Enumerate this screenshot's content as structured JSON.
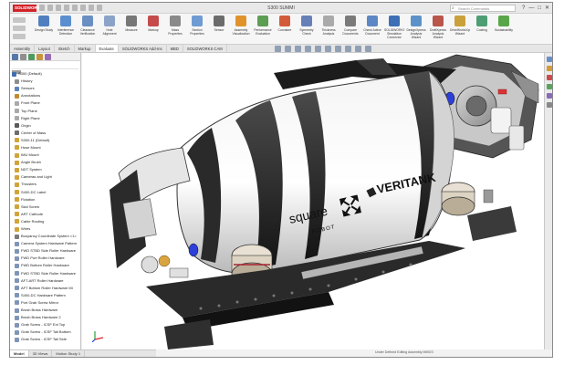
{
  "app": {
    "logo_text": "SOLIDWORKS",
    "window_title": "S300 SUMMI",
    "search_placeholder": "Search Commands",
    "window_buttons": [
      "?",
      "—",
      "□",
      "✕"
    ]
  },
  "ribbon": {
    "items": [
      {
        "label": "Design Study",
        "color": "#4f7fbf"
      },
      {
        "label": "Interference Detection",
        "color": "#5b8fd0"
      },
      {
        "label": "Clearance Verification",
        "color": "#6a8fc2"
      },
      {
        "label": "Hole Alignment",
        "color": "#8aa3c7"
      },
      {
        "label": "Measure",
        "color": "#777777"
      },
      {
        "label": "Markup",
        "color": "#c44c4c"
      },
      {
        "label": "Mass Properties",
        "color": "#8a8a8a"
      },
      {
        "label": "Section Properties",
        "color": "#6f9bd3"
      },
      {
        "label": "Sensor",
        "color": "#6c6c6c"
      },
      {
        "label": "Assembly Visualization",
        "color": "#e0932b"
      },
      {
        "label": "Performance Evaluation",
        "color": "#5c9e52"
      },
      {
        "label": "Curvature",
        "color": "#d35b3b"
      },
      {
        "label": "Symmetry Check",
        "color": "#6780b8"
      },
      {
        "label": "Thickness Analysis",
        "color": "#aaaaaa"
      },
      {
        "label": "Compare Documents",
        "color": "#7a7a7a"
      },
      {
        "label": "Check Active Document",
        "color": "#5d86c4"
      },
      {
        "label": "SOLIDWORKS Simulation Connector",
        "color": "#3c6fb5"
      },
      {
        "label": "DesignXpress Analysis Wizard",
        "color": "#5d92c9"
      },
      {
        "label": "DraftXpress Analysis Wizard",
        "color": "#b9554a"
      },
      {
        "label": "DriveWorksXpress Wizard",
        "color": "#c9a13b"
      },
      {
        "label": "Costing",
        "color": "#4d9e73"
      },
      {
        "label": "Sustainability",
        "color": "#59a649"
      }
    ]
  },
  "tabs": [
    "Assembly",
    "Layout",
    "Sketch",
    "Markup",
    "Evaluate",
    "SOLIDWORKS Add-Ins",
    "MBD",
    "SOLIDWORKS CAM"
  ],
  "active_tab_index": 4,
  "feature_tree": {
    "tab_colors": [
      "#5576a8",
      "#8f8f8f",
      "#4f9a5e",
      "#c9923c",
      "#9a6bb5"
    ],
    "items": [
      {
        "label": "S300 (Default)",
        "icon": "assembly-icon",
        "color": "#3f6fb1"
      },
      {
        "label": "History",
        "icon": "history-icon",
        "color": "#8d8d8d"
      },
      {
        "label": "Sensors",
        "icon": "sensor-icon",
        "color": "#5c84b8"
      },
      {
        "label": "Annotations",
        "icon": "annotation-icon",
        "color": "#c28b2c"
      },
      {
        "label": "Front Plane",
        "icon": "plane-icon",
        "color": "#a9a9a9"
      },
      {
        "label": "Top Plane",
        "icon": "plane-icon",
        "color": "#a9a9a9"
      },
      {
        "label": "Right Plane",
        "icon": "plane-icon",
        "color": "#a9a9a9"
      },
      {
        "label": "Origin",
        "icon": "origin-icon",
        "color": "#5a5a5a"
      },
      {
        "label": "Center of Mass",
        "icon": "center-mass-icon",
        "color": "#6d6d6d"
      },
      {
        "label": "S300-11 (Default)",
        "icon": "part-icon",
        "color": "#d1a43a"
      },
      {
        "label": "Hose Mount",
        "icon": "part-icon",
        "color": "#d1a43a"
      },
      {
        "label": "IMU Mount",
        "icon": "part-icon",
        "color": "#d1a43a"
      },
      {
        "label": "Angle Brush",
        "icon": "part-icon",
        "color": "#d1a43a"
      },
      {
        "label": "NDT System",
        "icon": "part-icon",
        "color": "#d1a43a"
      },
      {
        "label": "Cameras and Light",
        "icon": "part-icon",
        "color": "#d1a43a"
      },
      {
        "label": "Thrusters",
        "icon": "part-icon",
        "color": "#d1a43a"
      },
      {
        "label": "S400-DC Label",
        "icon": "part-icon",
        "color": "#d1a43a"
      },
      {
        "label": "Flotation",
        "icon": "part-icon",
        "color": "#d1a43a"
      },
      {
        "label": "Skid Screw",
        "icon": "part-icon",
        "color": "#d1a43a"
      },
      {
        "label": "ART Cathode",
        "icon": "part-icon",
        "color": "#d1a43a"
      },
      {
        "label": "Cable Routing",
        "icon": "part-icon",
        "color": "#d1a43a"
      },
      {
        "label": "Wires",
        "icon": "part-icon",
        "color": "#d1a43a"
      },
      {
        "label": "Buoyancy Coordinate System <1>",
        "icon": "coordinate-icon",
        "color": "#7b7b7b"
      },
      {
        "label": "Camera System Hardware Pattern",
        "icon": "pattern-icon",
        "color": "#7f95b8"
      },
      {
        "label": "FWD STBD Side Roller Hardware",
        "icon": "pattern-icon",
        "color": "#7f95b8"
      },
      {
        "label": "FWD Port Roller Hardware",
        "icon": "pattern-icon",
        "color": "#7f95b8"
      },
      {
        "label": "FWD Bottom Roller Hardware",
        "icon": "pattern-icon",
        "color": "#7f95b8"
      },
      {
        "label": "FWD STBD Side Roller Hardware",
        "icon": "pattern-icon",
        "color": "#7f95b8"
      },
      {
        "label": "AFT-ART Roller Hardware",
        "icon": "pattern-icon",
        "color": "#7f95b8"
      },
      {
        "label": "AFT Bottom Roller Hardware Mi",
        "icon": "pattern-icon",
        "color": "#7f95b8"
      },
      {
        "label": "S400-DC Hardware Pattern",
        "icon": "pattern-icon",
        "color": "#7f95b8"
      },
      {
        "label": "Port Grab Screw Mirror",
        "icon": "mirror-icon",
        "color": "#7f95b8"
      },
      {
        "label": "Brush Brass Hardware",
        "icon": "pattern-icon",
        "color": "#7f95b8"
      },
      {
        "label": "Brush Brass Hardware 2",
        "icon": "pattern-icon",
        "color": "#7f95b8"
      },
      {
        "label": "Grab Screw - ICSF Ext Top",
        "icon": "pattern-icon",
        "color": "#7f95b8"
      },
      {
        "label": "Grab Screw - ICSF Tail Bottom",
        "icon": "pattern-icon",
        "color": "#7f95b8"
      },
      {
        "label": "Grab Screw - ICSF Tail Side",
        "icon": "pattern-icon",
        "color": "#7f95b8"
      }
    ]
  },
  "model": {
    "brand_left_line1": "square",
    "brand_left_line2": "ROBOT",
    "brand_right": "VERITANK"
  },
  "bottom_tabs": [
    "Model",
    "3D Views",
    "Motion Study 1"
  ],
  "active_bottom_tab_index": 0,
  "status_text": "Under Defined   Editing Assembly   MMGS"
}
